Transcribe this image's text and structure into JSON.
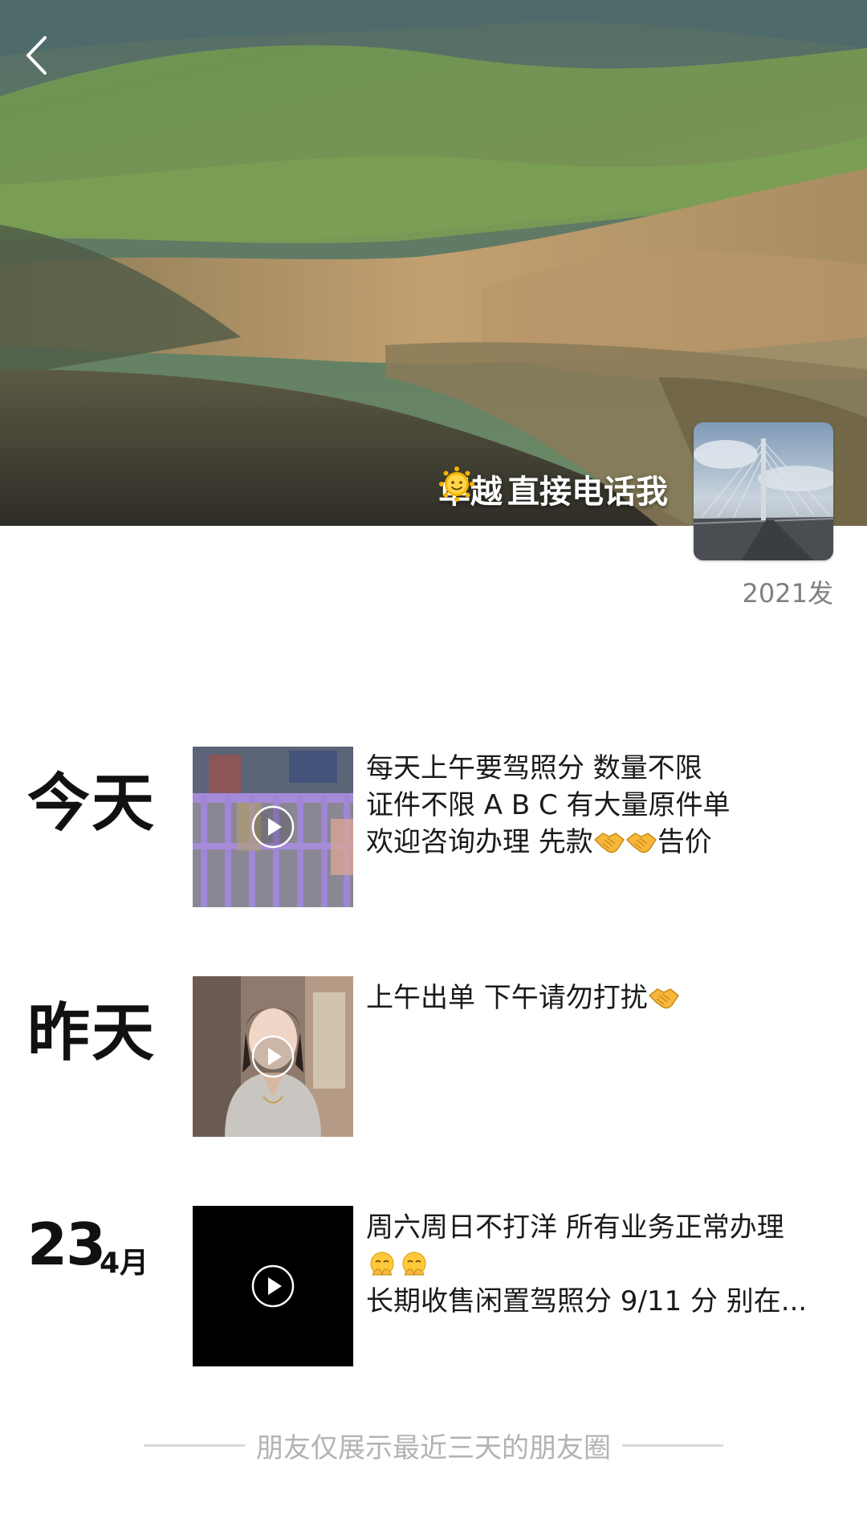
{
  "profile": {
    "nickname_part1": "卓越",
    "nickname_part2": "直接电话我",
    "signature": "2021发"
  },
  "posts": [
    {
      "day_label": "今天",
      "lines": [
        "每天上午要驾照分 数量不限",
        "证件不限 A B C 有大量原件单",
        "欢迎咨询办理 先款",
        "告价"
      ]
    },
    {
      "day_label": "昨天",
      "lines": [
        "上午出单 下午请勿打扰"
      ]
    },
    {
      "date_day": "23",
      "date_month": "4月",
      "lines": [
        "周六周日不打洋 所有业务正常办理",
        "长期收售闲置驾照分 9/11 分 别在..."
      ]
    }
  ],
  "footer": {
    "note": "朋友仅展示最近三天的朋友圈"
  },
  "icons": {
    "back": "chevron-left-icon",
    "play": "play-icon",
    "sun": "sun-face-emoji",
    "handshake": "handshake-emoji",
    "face": "shushing-face-emoji"
  },
  "colors": {
    "signature": "#808080",
    "footer_text": "#b3b3b3",
    "divider": "#d9d9d9"
  }
}
